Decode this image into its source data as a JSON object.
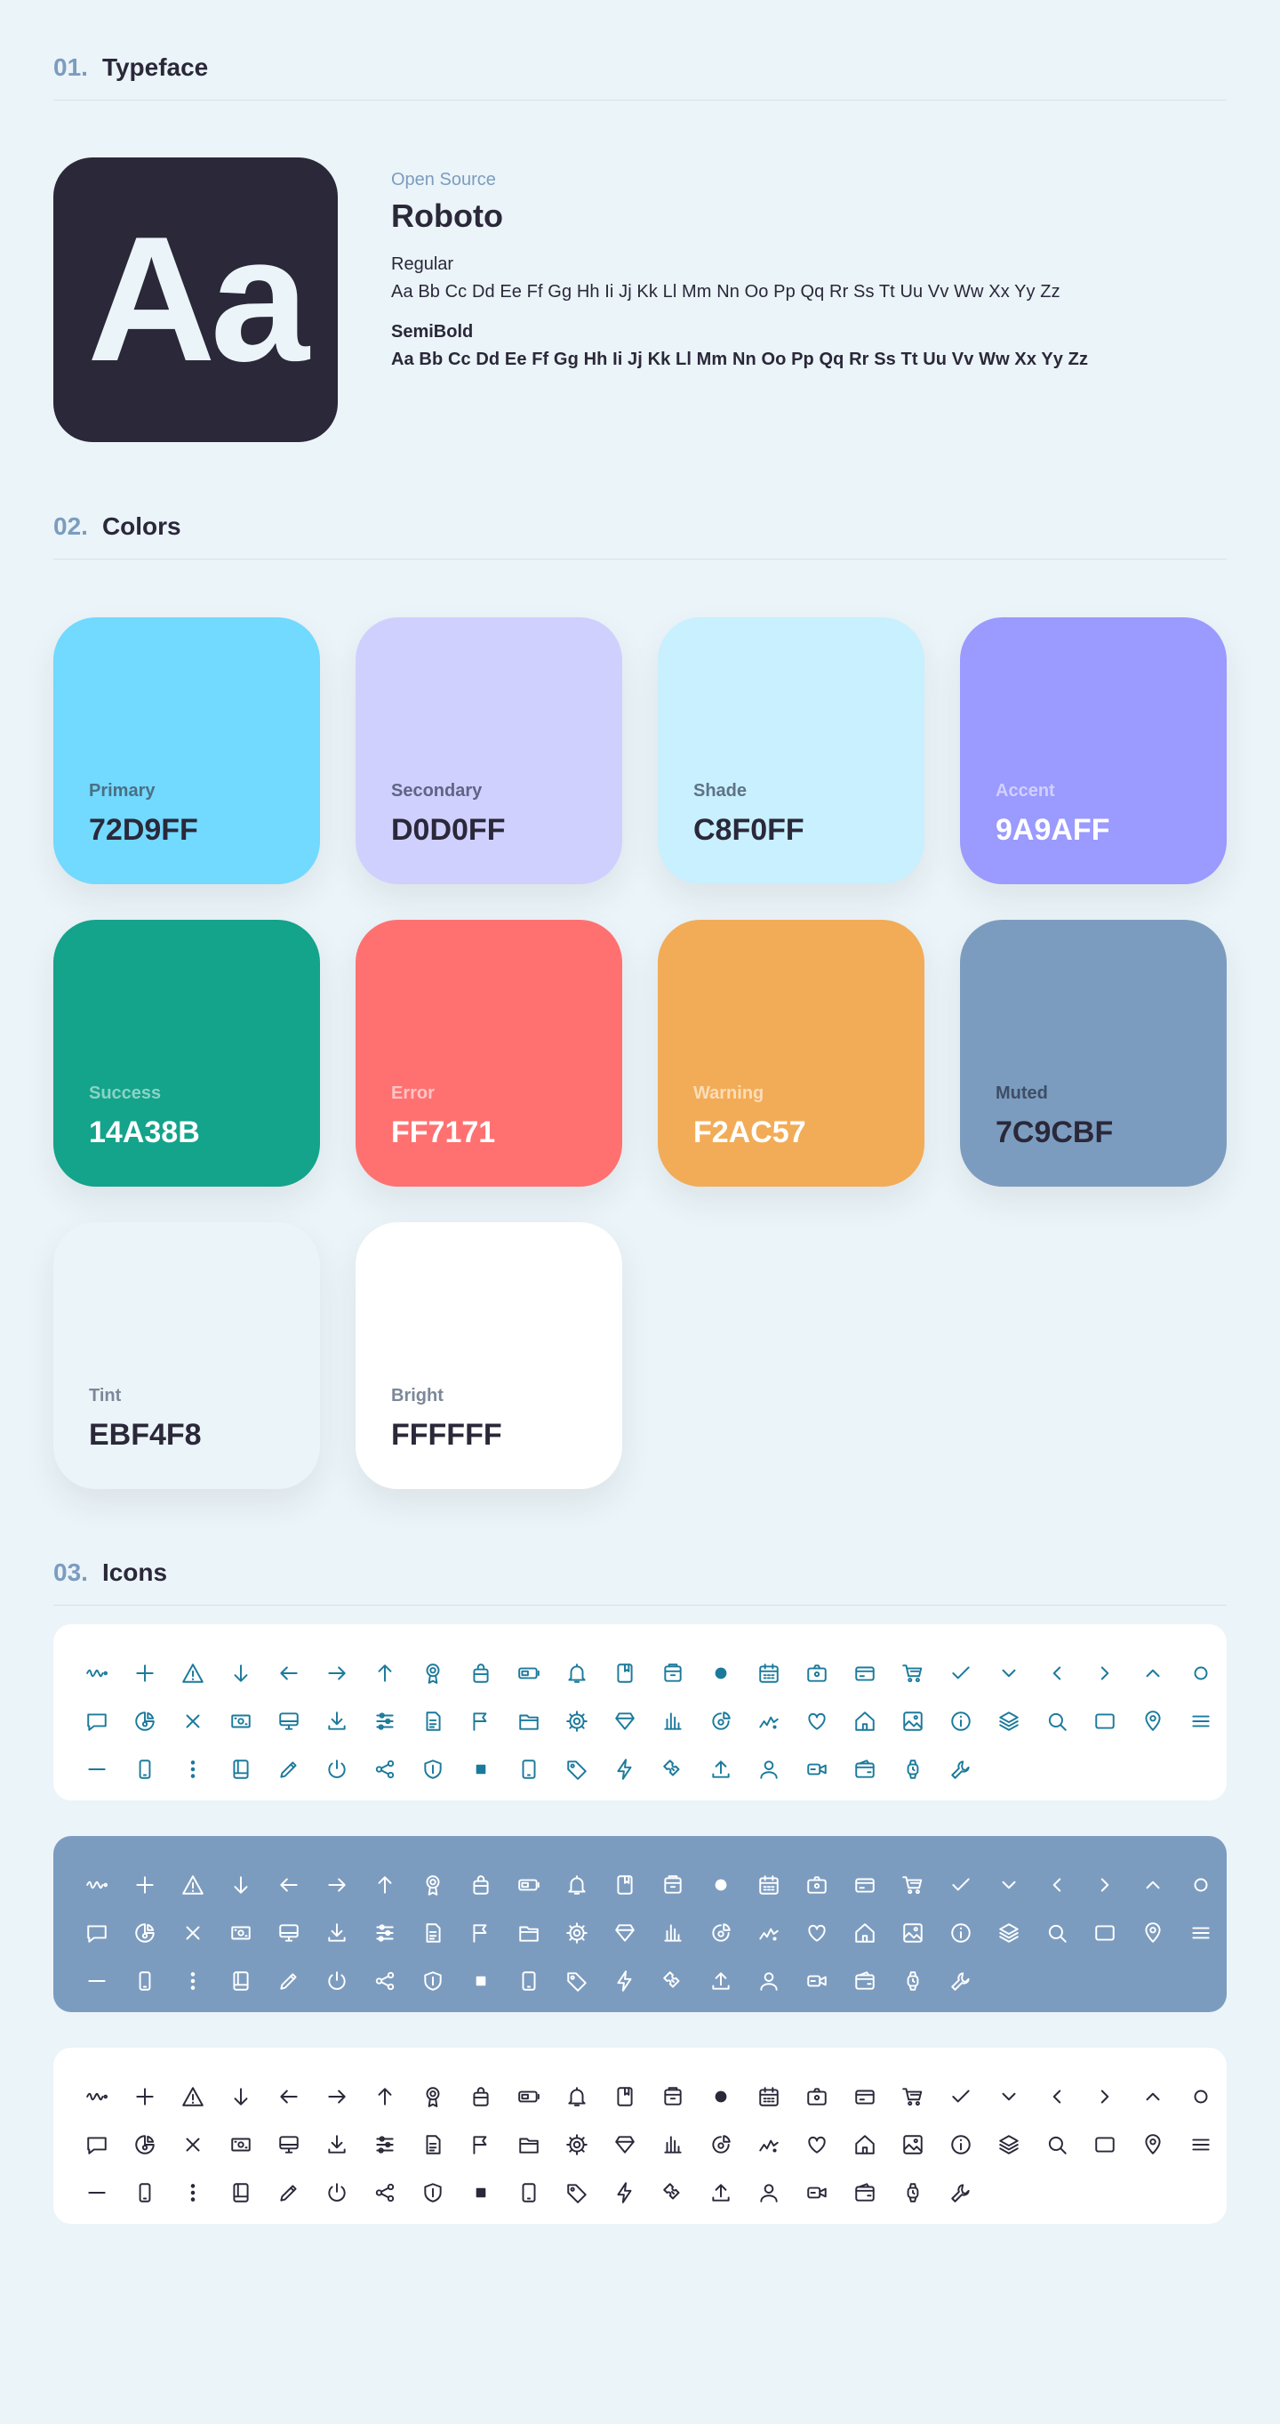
{
  "sections": {
    "typeface": {
      "num": "01.",
      "title": "Typeface"
    },
    "colors": {
      "num": "02.",
      "title": "Colors"
    },
    "icons": {
      "num": "03.",
      "title": "Icons"
    }
  },
  "typeface": {
    "sample": "Aa",
    "source": "Open Source",
    "name": "Roboto",
    "regular_label": "Regular",
    "semibold_label": "SemiBold",
    "alphabet": "Aa Bb Cc Dd Ee Ff Gg Hh Ii Jj Kk Ll Mm Nn Oo Pp Qq Rr Ss Tt Uu Vv Ww Xx Yy Zz"
  },
  "colors": [
    {
      "label": "Primary",
      "hex": "72D9FF",
      "bg": "#72D9FF",
      "labelColor": "#4A6F85",
      "hexColor": "#2A2839"
    },
    {
      "label": "Secondary",
      "hex": "D0D0FF",
      "bg": "#D0D0FF",
      "labelColor": "#5E6585",
      "hexColor": "#2A2839"
    },
    {
      "label": "Shade",
      "hex": "C8F0FF",
      "bg": "#C8F0FF",
      "labelColor": "#5E7385",
      "hexColor": "#2A2839"
    },
    {
      "label": "Accent",
      "hex": "9A9AFF",
      "bg": "#9A9AFF",
      "labelColor": "#D0D0FF",
      "hexColor": "#FFFFFF"
    },
    {
      "label": "Success",
      "hex": "14A38B",
      "bg": "#14A38B",
      "labelColor": "#8BD3C5",
      "hexColor": "#FFFFFF"
    },
    {
      "label": "Error",
      "hex": "FF7171",
      "bg": "#FF7171",
      "labelColor": "#FFC4C4",
      "hexColor": "#FFFFFF"
    },
    {
      "label": "Warning",
      "hex": "F2AC57",
      "bg": "#F2AC57",
      "labelColor": "#FBDDB8",
      "hexColor": "#FFFFFF"
    },
    {
      "label": "Muted",
      "hex": "7C9CBF",
      "bg": "#7C9CBF",
      "labelColor": "#3E4E66",
      "hexColor": "#2A2839"
    },
    {
      "label": "Tint",
      "hex": "EBF4F8",
      "bg": "#EBF4F8",
      "labelColor": "#7C8898",
      "hexColor": "#2A2839"
    },
    {
      "label": "Bright",
      "hex": "FFFFFF",
      "bg": "#FFFFFF",
      "labelColor": "#7C8898",
      "hexColor": "#2A2839"
    }
  ],
  "icon_rows": [
    [
      "activity-icon",
      "plus-icon",
      "warning-icon",
      "arrow-down-icon",
      "arrow-left-icon",
      "arrow-right-icon",
      "arrow-up-icon",
      "award-icon",
      "bag-icon",
      "battery-icon",
      "bell-icon",
      "bookmark-icon",
      "box-icon",
      "dot-icon",
      "calendar-icon",
      "camera-icon",
      "card-icon",
      "cart-icon",
      "check-icon",
      "chevron-down-icon",
      "chevron-left-icon",
      "chevron-right-icon",
      "chevron-up-icon",
      "circle-icon"
    ],
    [
      "chat-icon",
      "pie-chart-icon",
      "close-icon",
      "cash-icon",
      "monitor-icon",
      "download-icon",
      "sliders-icon",
      "document-icon",
      "flag-icon",
      "folder-icon",
      "settings-icon",
      "diamond-icon",
      "bar-chart-icon",
      "chart-donut-icon",
      "stats-icon",
      "heart-icon",
      "home-icon",
      "image-icon",
      "info-icon",
      "layers-icon",
      "search-icon",
      "window-icon",
      "location-icon",
      "menu-icon"
    ],
    [
      "minus-icon",
      "phone-icon",
      "more-vertical-icon",
      "notebook-icon",
      "pencil-icon",
      "power-icon",
      "share-icon",
      "shield-icon",
      "stop-icon",
      "tablet-icon",
      "tag-icon",
      "lightning-icon",
      "ticket-icon",
      "upload-icon",
      "user-icon",
      "video-icon",
      "wallet-icon",
      "watch-icon",
      "wrench-icon"
    ]
  ],
  "icon_panels": [
    {
      "bg": "#FFFFFF",
      "color": "#1B7A9C"
    },
    {
      "bg": "#7C9CBF",
      "color": "#FFFFFF"
    },
    {
      "bg": "#FFFFFF",
      "color": "#2A2839"
    }
  ]
}
